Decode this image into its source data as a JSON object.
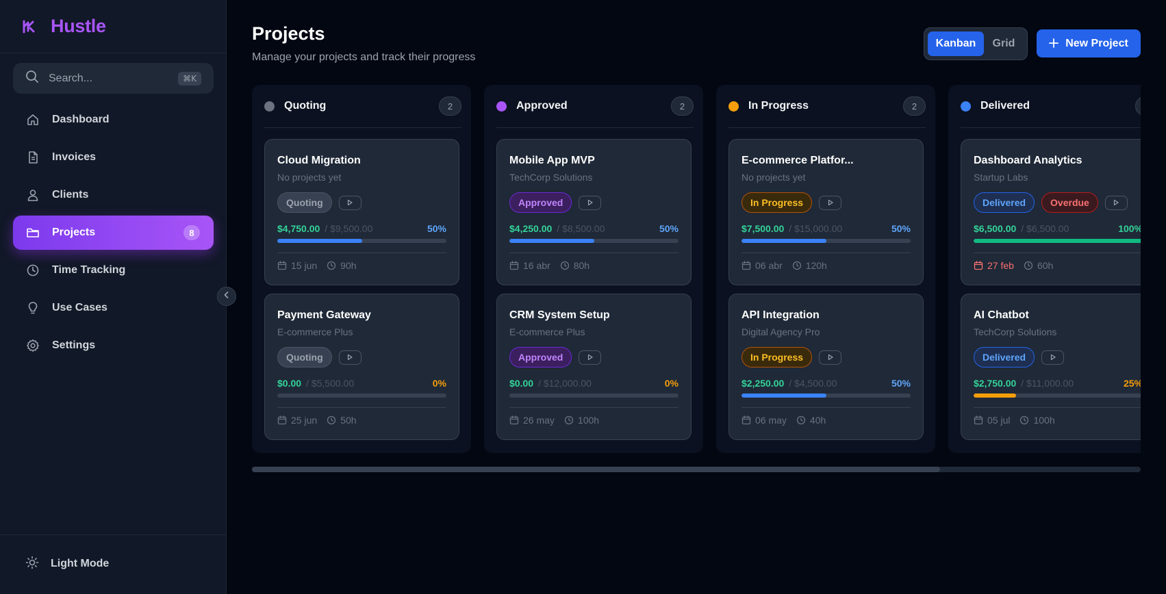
{
  "app": {
    "name": "Hustle"
  },
  "search": {
    "placeholder": "Search...",
    "shortcut": "⌘K"
  },
  "sidebar": {
    "items": [
      {
        "label": "Dashboard",
        "icon": "home-icon"
      },
      {
        "label": "Invoices",
        "icon": "document-icon"
      },
      {
        "label": "Clients",
        "icon": "user-icon"
      },
      {
        "label": "Projects",
        "icon": "folder-icon",
        "badge": "8",
        "active": true
      },
      {
        "label": "Time Tracking",
        "icon": "clock-icon"
      },
      {
        "label": "Use Cases",
        "icon": "lightbulb-icon"
      },
      {
        "label": "Settings",
        "icon": "gear-icon"
      }
    ],
    "footer": {
      "label": "Light Mode",
      "icon": "sun-icon"
    }
  },
  "header": {
    "title": "Projects",
    "subtitle": "Manage your projects and track their progress",
    "view_toggle": {
      "kanban": "Kanban",
      "grid": "Grid",
      "selected": "Kanban"
    },
    "new_button": "New Project"
  },
  "colors": {
    "accent": "#2563eb",
    "brand": "#a855f7",
    "quoting": "#6b7280",
    "approved": "#a855f7",
    "in_progress": "#f59e0b",
    "delivered": "#3b82f6",
    "amount": "#34d399",
    "overdue": "#f87171"
  },
  "columns": [
    {
      "title": "Quoting",
      "count": "2",
      "cards": [
        {
          "title": "Cloud Migration",
          "client": "No projects yet",
          "status": "Quoting",
          "amount": "$4,750.00",
          "total": "/ $9,500.00",
          "percent": "50%",
          "progress": 0.5,
          "date": "15 jun",
          "hours": "90h"
        },
        {
          "title": "Payment Gateway",
          "client": "E-commerce Plus",
          "status": "Quoting",
          "amount": "$0.00",
          "total": "/ $5,500.00",
          "percent": "0%",
          "progress": 0,
          "date": "25 jun",
          "hours": "50h"
        }
      ]
    },
    {
      "title": "Approved",
      "count": "2",
      "cards": [
        {
          "title": "Mobile App MVP",
          "client": "TechCorp Solutions",
          "status": "Approved",
          "amount": "$4,250.00",
          "total": "/ $8,500.00",
          "percent": "50%",
          "progress": 0.5,
          "date": "16 abr",
          "hours": "80h"
        },
        {
          "title": "CRM System Setup",
          "client": "E-commerce Plus",
          "status": "Approved",
          "amount": "$0.00",
          "total": "/ $12,000.00",
          "percent": "0%",
          "progress": 0,
          "date": "26 may",
          "hours": "100h"
        }
      ]
    },
    {
      "title": "In Progress",
      "count": "2",
      "cards": [
        {
          "title": "E-commerce Platfor...",
          "client": "No projects yet",
          "status": "In Progress",
          "amount": "$7,500.00",
          "total": "/ $15,000.00",
          "percent": "50%",
          "progress": 0.5,
          "date": "06 abr",
          "hours": "120h"
        },
        {
          "title": "API Integration",
          "client": "Digital Agency Pro",
          "status": "In Progress",
          "amount": "$2,250.00",
          "total": "/ $4,500.00",
          "percent": "50%",
          "progress": 0.5,
          "date": "06 may",
          "hours": "40h"
        }
      ]
    },
    {
      "title": "Delivered",
      "count": "",
      "cards": [
        {
          "title": "Dashboard Analytics",
          "client": "Startup Labs",
          "status": "Delivered",
          "extra_status": "Overdue",
          "amount": "$6,500.00",
          "total": "/ $6,500.00",
          "percent": "100%",
          "progress": 1,
          "date": "27 feb",
          "hours": "60h"
        },
        {
          "title": "AI Chatbot",
          "client": "TechCorp Solutions",
          "status": "Delivered",
          "amount": "$2,750.00",
          "total": "/ $11,000.00",
          "percent": "25%",
          "progress": 0.25,
          "date": "05 jul",
          "hours": "100h"
        }
      ]
    }
  ],
  "scroll": {
    "horizontal_position": 0.77
  }
}
